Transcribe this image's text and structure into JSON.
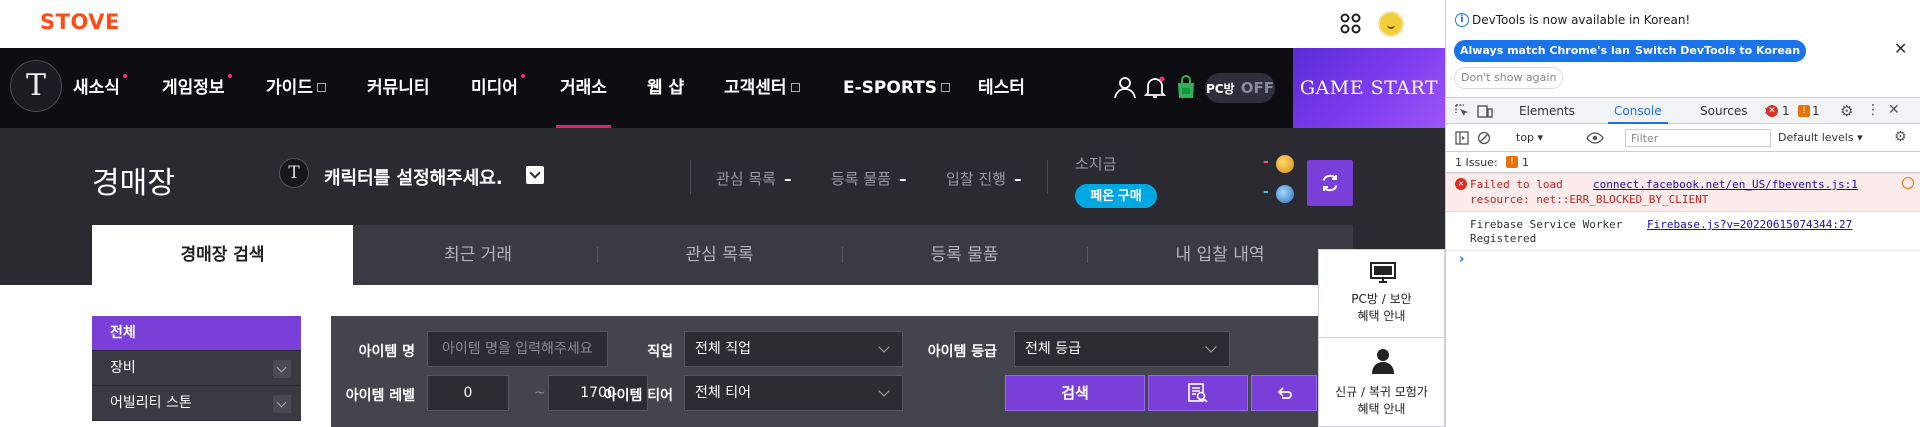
{
  "stove": {
    "logo": "STOVE"
  },
  "gnb": {
    "logo_glyph": "T",
    "items": [
      {
        "label": "새소식"
      },
      {
        "label": "게임정보"
      },
      {
        "label": "가이드"
      },
      {
        "label": "커뮤니티"
      },
      {
        "label": "미디어"
      },
      {
        "label": "거래소"
      },
      {
        "label": "웹 샵"
      },
      {
        "label": "고객센터"
      },
      {
        "label": "E-SPORTS"
      },
      {
        "label": "테스터"
      }
    ],
    "pc_badge": "PC방",
    "pc_badge_state": "OFF",
    "game_start": "GAME START"
  },
  "auction": {
    "title": "경매장",
    "char_emblem": "T",
    "char_select": "캐릭터를 설정해주세요.",
    "stats": [
      {
        "label": "관심 목록",
        "value": "–"
      },
      {
        "label": "등록 물품",
        "value": "–"
      },
      {
        "label": "입찰 진행",
        "value": "–"
      }
    ],
    "money_label": "소지금",
    "pheon_button": "페온 구매",
    "gold_value": "-",
    "crystal_value": "-",
    "colors": {
      "gold_dash": "#ff4a8a",
      "crystal_dash": "#3fb7f0",
      "accent": "#7a3fd9"
    },
    "tabs": [
      {
        "label": "경매장 검색"
      },
      {
        "label": "최근 거래"
      },
      {
        "label": "관심 목록"
      },
      {
        "label": "등록 물품"
      },
      {
        "label": "내 입찰 내역"
      }
    ]
  },
  "categories": [
    {
      "label": "전체"
    },
    {
      "label": "장비"
    },
    {
      "label": "어빌리티 스톤"
    }
  ],
  "search": {
    "item_name_label": "아이템 명",
    "item_name_placeholder": "아이템 명을 입력해주세요.",
    "class_label": "직업",
    "class_value": "전체 직업",
    "grade_label": "아이템 등급",
    "grade_value": "전체 등급",
    "level_label": "아이템 레벨",
    "level_min": "0",
    "level_sep": "~",
    "level_max": "1700",
    "tier_label": "아이템 티어",
    "tier_value": "전체 티어",
    "search_button": "검색"
  },
  "side_float": {
    "pc_line1": "PC방 / 보안",
    "pc_line2": "혜택 안내",
    "new_line1": "신규 / 복귀 모험가",
    "new_line2": "혜택 안내"
  },
  "devtools": {
    "notice": "DevTools is now available in Korean!",
    "btn_match": "Always match Chrome's language",
    "btn_switch": "Switch DevTools to Korean",
    "btn_dont_show": "Don't show again",
    "tabs": [
      {
        "label": "Elements"
      },
      {
        "label": "Console"
      },
      {
        "label": "Sources"
      }
    ],
    "more_tabs": "»",
    "error_count": "1",
    "warn_count": "1",
    "context": "top",
    "filter_placeholder": "Filter",
    "levels": "Default levels",
    "issues_label": "1 Issue:",
    "issues_count": "1",
    "error_line1": "Failed to load",
    "error_link": "connect.facebook.net/en_US/fbevents.js:1",
    "error_line2": "resource: net::ERR_BLOCKED_BY_CLIENT",
    "log_line1": "Firebase Service Worker",
    "log_line2": "Registered",
    "log_link": "Firebase.js?v=20220615074344:27",
    "prompt": "›"
  }
}
